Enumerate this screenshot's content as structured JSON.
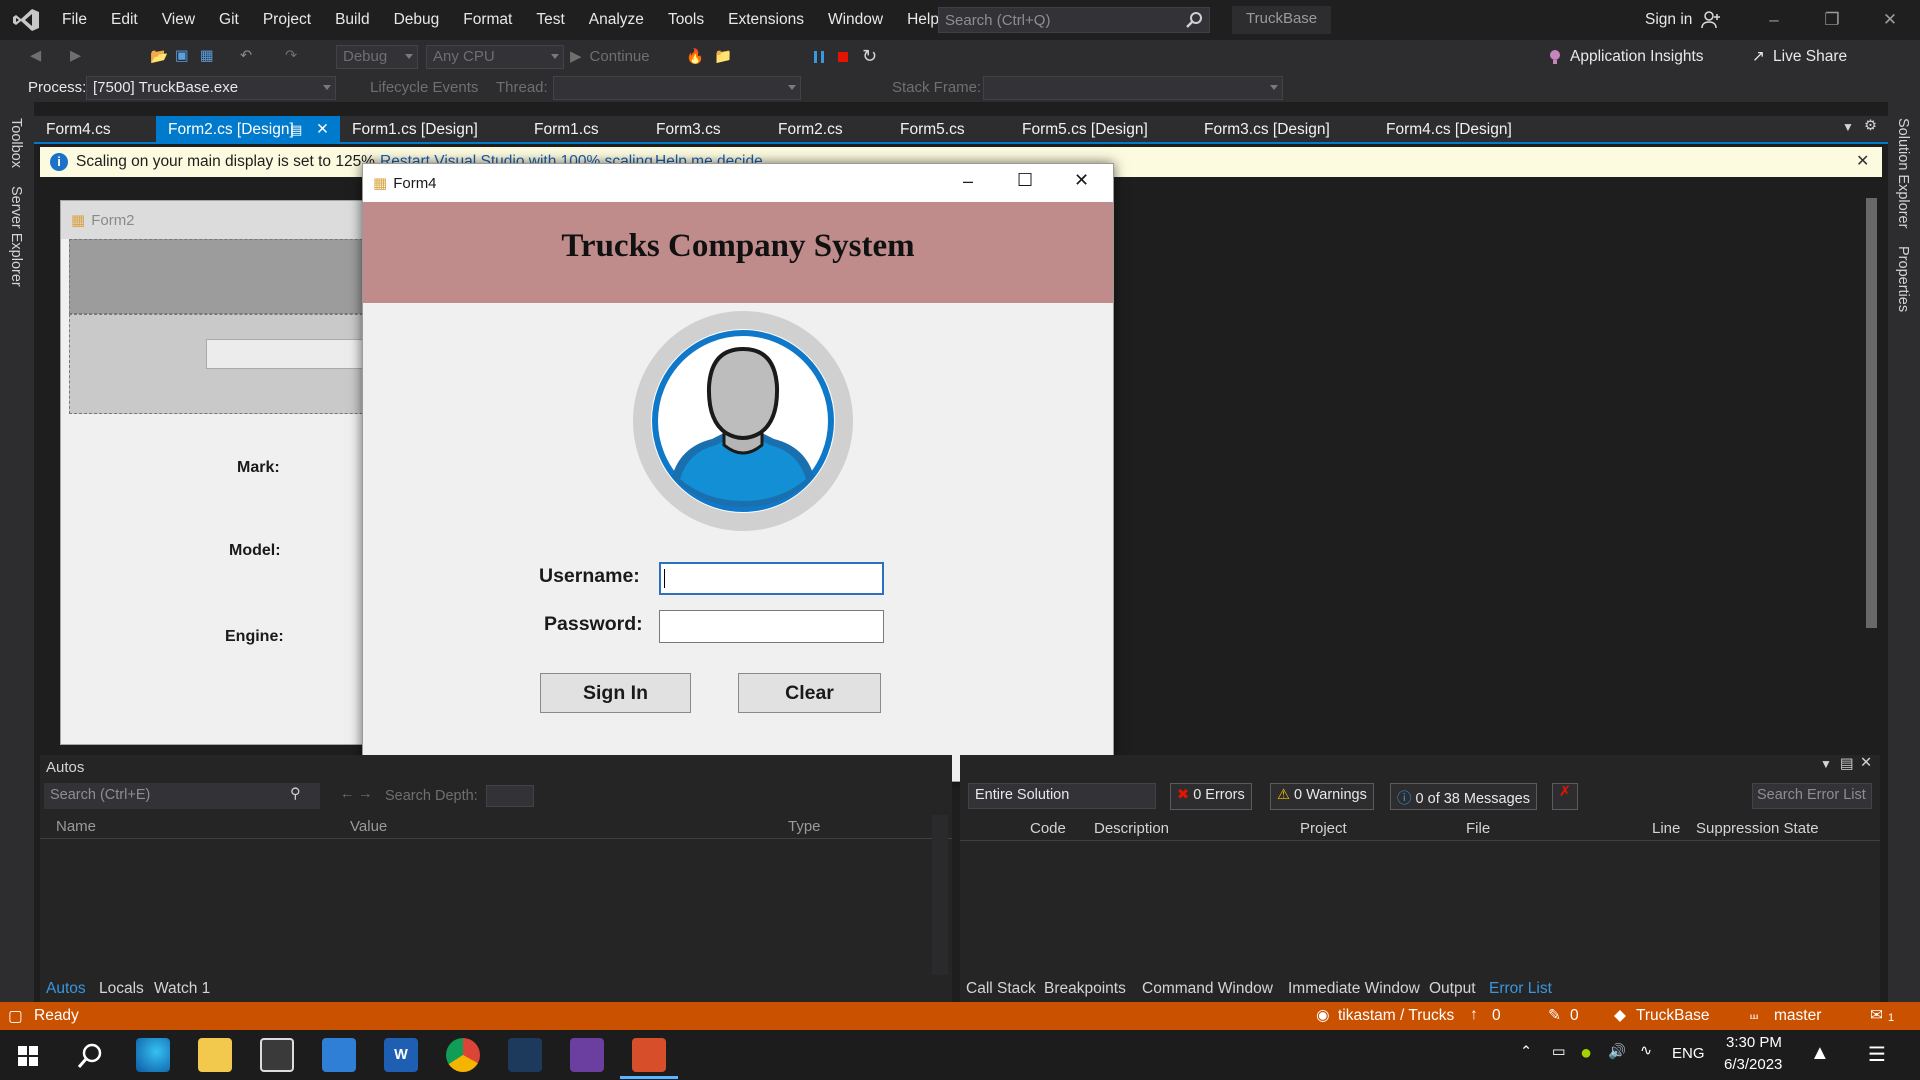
{
  "menubar": {
    "items": [
      "File",
      "Edit",
      "View",
      "Git",
      "Project",
      "Build",
      "Debug",
      "Format",
      "Test",
      "Analyze",
      "Tools",
      "Extensions",
      "Window",
      "Help"
    ]
  },
  "vs_search": {
    "placeholder": "Search (Ctrl+Q)"
  },
  "solution_name": "TruckBase",
  "signin_label": "Sign in",
  "toolbar": {
    "config": "Debug",
    "platform": "Any CPU",
    "continue": "Continue",
    "app_insights": "Application Insights",
    "live_share": "Live Share"
  },
  "debugbar": {
    "process_label": "Process:",
    "process_value": "[7500] TruckBase.exe",
    "lifecycle": "Lifecycle Events",
    "thread_label": "Thread:",
    "stack_label": "Stack Frame:"
  },
  "left_rail": [
    "Toolbox",
    "Server Explorer"
  ],
  "right_rail": [
    "Solution Explorer",
    "Properties"
  ],
  "tabs": [
    {
      "label": "Form4.cs"
    },
    {
      "label": "Form2.cs [Design]",
      "active": true
    },
    {
      "label": "Form1.cs [Design]"
    },
    {
      "label": "Form1.cs"
    },
    {
      "label": "Form3.cs"
    },
    {
      "label": "Form2.cs"
    },
    {
      "label": "Form5.cs"
    },
    {
      "label": "Form5.cs [Design]"
    },
    {
      "label": "Form3.cs [Design]"
    },
    {
      "label": "Form4.cs [Design]"
    }
  ],
  "infobar": {
    "message": "Scaling on your main display is set to 125%.",
    "link1": "Restart Visual Studio with 100% scaling",
    "link2": "Help me decide"
  },
  "form2": {
    "title": "Form2",
    "labels": [
      "Mark:",
      "Model:",
      "Engine:"
    ]
  },
  "form4": {
    "title": "Form4",
    "heading": "Trucks Company System",
    "username_label": "Username:",
    "password_label": "Password:",
    "signin_button": "Sign In",
    "clear_button": "Clear"
  },
  "autos": {
    "title": "Autos",
    "search_placeholder": "Search (Ctrl+E)",
    "depth_label": "Search Depth:",
    "columns": [
      "Name",
      "Value",
      "Type"
    ],
    "tabs": [
      "Autos",
      "Locals",
      "Watch 1"
    ]
  },
  "errorlist": {
    "scope": "Entire Solution",
    "errors": "0 Errors",
    "warnings": "0 Warnings",
    "messages": "0 of 38 Messages",
    "search_placeholder": "Search Error List",
    "columns": [
      "Code",
      "Description",
      "Project",
      "File",
      "Line",
      "Suppression State"
    ],
    "tabs": [
      "Call Stack",
      "Breakpoints",
      "Command Window",
      "Immediate Window",
      "Output",
      "Error List"
    ]
  },
  "statusbar": {
    "ready": "Ready",
    "repo": "tikastam / Trucks",
    "up_count": "0",
    "pencil_count": "0",
    "project": "TruckBase",
    "branch": "master",
    "notif": "1"
  },
  "taskbar": {
    "lang": "ENG",
    "time": "3:30 PM",
    "date": "6/3/2023"
  },
  "colors": {
    "accent": "#007acc",
    "status": "#ca5100",
    "form_header": "#bf8b8b",
    "avatar_blue": "#0f78c8"
  }
}
